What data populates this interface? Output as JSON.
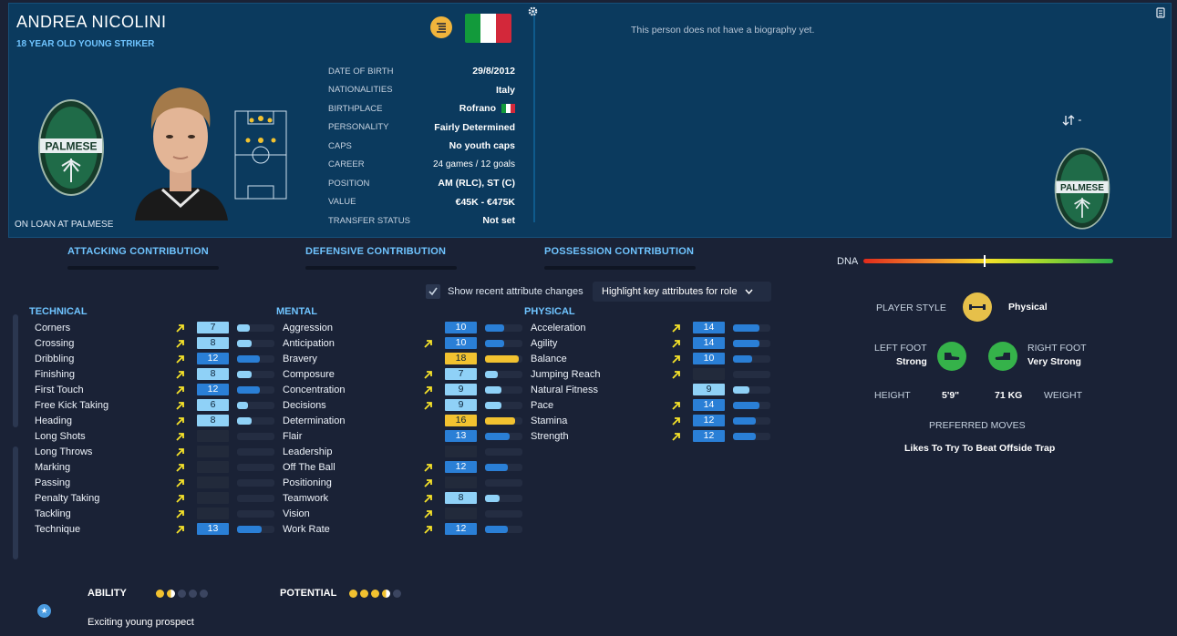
{
  "player": {
    "name": "ANDREA NICOLINI",
    "subtitle": "18 YEAR OLD YOUNG STRIKER",
    "loan_status": "ON LOAN AT PALMESE",
    "club_crest_text": "PALMESE"
  },
  "facts": [
    {
      "label": "DATE OF BIRTH",
      "value": "29/8/2012"
    },
    {
      "label": "NATIONALITIES",
      "value": "Italy"
    },
    {
      "label": "BIRTHPLACE",
      "value": "Rofrano"
    },
    {
      "label": "PERSONALITY",
      "value": "Fairly Determined"
    },
    {
      "label": "CAPS",
      "value": "No youth caps"
    },
    {
      "label": "CAREER",
      "value": "24 games /   12 goals"
    },
    {
      "label": "POSITION",
      "value": "AM (RLC), ST (C)"
    },
    {
      "label": "VALUE",
      "value": "€45K - €475K"
    },
    {
      "label": "TRANSFER STATUS",
      "value": "Not set"
    }
  ],
  "bio": "This person does not have a biography yet.",
  "transfer_value": "-",
  "contributions": [
    "ATTACKING CONTRIBUTION",
    "DEFENSIVE CONTRIBUTION",
    "POSSESSION CONTRIBUTION"
  ],
  "dna": {
    "label": "DNA",
    "level": 0.48
  },
  "controls": {
    "recent_changes_label": "Show recent attribute changes",
    "recent_changes_checked": true,
    "highlight_label": "Highlight key attributes for role"
  },
  "colors": {
    "light": "#8fd1f7",
    "blue": "#2a7fd6",
    "gold": "#f2c230",
    "dim": "#222a3b",
    "arrow": "#f5e22a"
  },
  "technical": {
    "title": "TECHNICAL",
    "items": [
      {
        "name": "Corners",
        "value": "7",
        "level": 0.35,
        "tier": "light",
        "arrow": true
      },
      {
        "name": "Crossing",
        "value": "8",
        "level": 0.4,
        "tier": "light",
        "arrow": true
      },
      {
        "name": "Dribbling",
        "value": "12",
        "level": 0.6,
        "tier": "blue",
        "arrow": true
      },
      {
        "name": "Finishing",
        "value": "8",
        "level": 0.4,
        "tier": "light",
        "arrow": true
      },
      {
        "name": "First Touch",
        "value": "12",
        "level": 0.6,
        "tier": "blue",
        "arrow": true
      },
      {
        "name": "Free Kick Taking",
        "value": "6",
        "level": 0.3,
        "tier": "light",
        "arrow": true
      },
      {
        "name": "Heading",
        "value": "8",
        "level": 0.4,
        "tier": "light",
        "arrow": true
      },
      {
        "name": "Long Shots",
        "value": "",
        "level": 0,
        "tier": "dim",
        "arrow": true
      },
      {
        "name": "Long Throws",
        "value": "",
        "level": 0,
        "tier": "dim",
        "arrow": true
      },
      {
        "name": "Marking",
        "value": "",
        "level": 0,
        "tier": "dim",
        "arrow": true
      },
      {
        "name": "Passing",
        "value": "",
        "level": 0,
        "tier": "dim",
        "arrow": true
      },
      {
        "name": "Penalty Taking",
        "value": "",
        "level": 0,
        "tier": "dim",
        "arrow": true
      },
      {
        "name": "Tackling",
        "value": "",
        "level": 0,
        "tier": "dim",
        "arrow": true
      },
      {
        "name": "Technique",
        "value": "13",
        "level": 0.65,
        "tier": "blue",
        "arrow": true
      }
    ]
  },
  "mental": {
    "title": "MENTAL",
    "items": [
      {
        "name": "Aggression",
        "value": "10",
        "level": 0.5,
        "tier": "blue",
        "arrow": false
      },
      {
        "name": "Anticipation",
        "value": "10",
        "level": 0.5,
        "tier": "blue",
        "arrow": true
      },
      {
        "name": "Bravery",
        "value": "18",
        "level": 0.9,
        "tier": "gold",
        "arrow": false
      },
      {
        "name": "Composure",
        "value": "7",
        "level": 0.35,
        "tier": "light",
        "arrow": true
      },
      {
        "name": "Concentration",
        "value": "9",
        "level": 0.45,
        "tier": "light",
        "arrow": true
      },
      {
        "name": "Decisions",
        "value": "9",
        "level": 0.45,
        "tier": "light",
        "arrow": true
      },
      {
        "name": "Determination",
        "value": "16",
        "level": 0.8,
        "tier": "gold",
        "arrow": false
      },
      {
        "name": "Flair",
        "value": "13",
        "level": 0.65,
        "tier": "blue",
        "arrow": false
      },
      {
        "name": "Leadership",
        "value": "",
        "level": 0,
        "tier": "dim",
        "arrow": false
      },
      {
        "name": "Off The Ball",
        "value": "12",
        "level": 0.6,
        "tier": "blue",
        "arrow": true
      },
      {
        "name": "Positioning",
        "value": "",
        "level": 0,
        "tier": "dim",
        "arrow": true
      },
      {
        "name": "Teamwork",
        "value": "8",
        "level": 0.4,
        "tier": "light",
        "arrow": true
      },
      {
        "name": "Vision",
        "value": "",
        "level": 0,
        "tier": "dim",
        "arrow": true
      },
      {
        "name": "Work Rate",
        "value": "12",
        "level": 0.6,
        "tier": "blue",
        "arrow": true
      }
    ]
  },
  "physical": {
    "title": "PHYSICAL",
    "items": [
      {
        "name": "Acceleration",
        "value": "14",
        "level": 0.7,
        "tier": "blue",
        "arrow": true
      },
      {
        "name": "Agility",
        "value": "14",
        "level": 0.7,
        "tier": "blue",
        "arrow": true
      },
      {
        "name": "Balance",
        "value": "10",
        "level": 0.5,
        "tier": "blue",
        "arrow": true
      },
      {
        "name": "Jumping Reach",
        "value": "",
        "level": 0,
        "tier": "dim",
        "arrow": true
      },
      {
        "name": "Natural Fitness",
        "value": "9",
        "level": 0.45,
        "tier": "light",
        "arrow": false
      },
      {
        "name": "Pace",
        "value": "14",
        "level": 0.7,
        "tier": "blue",
        "arrow": true
      },
      {
        "name": "Stamina",
        "value": "12",
        "level": 0.6,
        "tier": "blue",
        "arrow": true
      },
      {
        "name": "Strength",
        "value": "12",
        "level": 0.6,
        "tier": "blue",
        "arrow": true
      }
    ]
  },
  "profile": {
    "player_style_label": "PLAYER STYLE",
    "player_style": "Physical",
    "left_foot_label": "LEFT FOOT",
    "left_foot": "Strong",
    "right_foot_label": "RIGHT FOOT",
    "right_foot": "Very Strong",
    "height_label": "HEIGHT",
    "height": "5'9\"",
    "weight": "71 KG",
    "weight_label": "WEIGHT",
    "preferred_moves_label": "PREFERRED MOVES",
    "preferred_moves": "Likes To Try To Beat Offside Trap"
  },
  "footer": {
    "ability_label": "ABILITY",
    "ability_stars": 1.5,
    "potential_label": "POTENTIAL",
    "potential_stars": 3.5,
    "stars_max": 5,
    "prospect": "Exciting young prospect"
  }
}
